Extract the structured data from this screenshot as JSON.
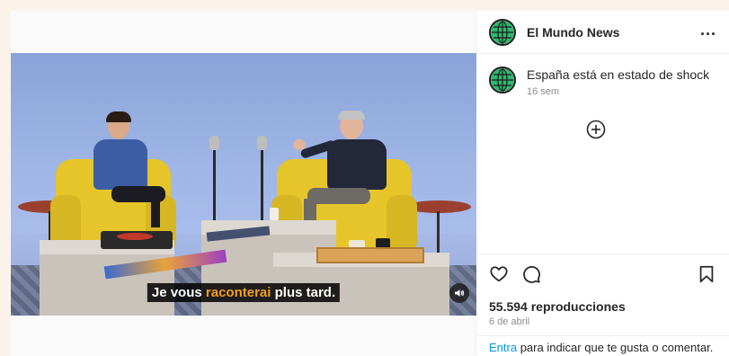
{
  "post": {
    "account_name": "El Mundo News",
    "more_label": "...",
    "caption": "España está en estado de shock",
    "caption_time": "16 sem",
    "views": "55.594 reproducciones",
    "date": "6 de abril"
  },
  "video": {
    "subtitle_before": "Je vous ",
    "subtitle_highlight": "raconterai",
    "subtitle_after": " plus tard.",
    "subtitle_highlight_color": "#f3a01c"
  },
  "footer": {
    "login_link": "Entra",
    "login_text": " para indicar que te gusta o comentar."
  },
  "colors": {
    "background": "#fbf3e9",
    "link": "#0095f6",
    "chair": "#e6c52a"
  },
  "icons": {
    "like": "heart-icon",
    "comment": "comment-icon",
    "save": "bookmark-icon",
    "audio": "speaker-icon",
    "add": "plus-circle-icon"
  }
}
